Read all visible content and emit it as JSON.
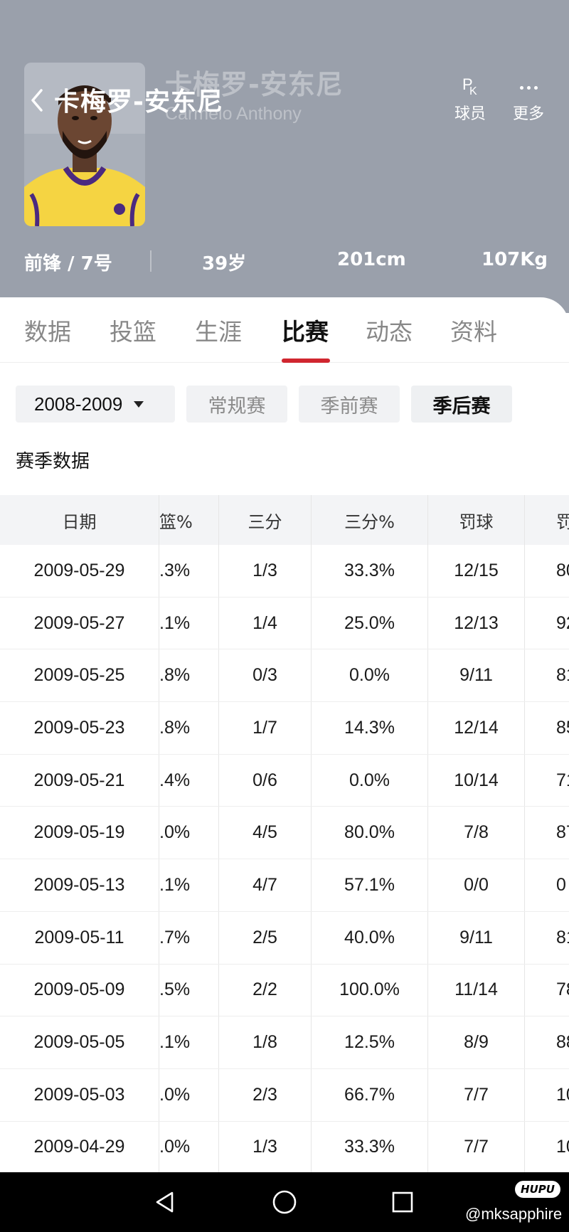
{
  "header": {
    "name_cn": "卡梅罗-安东尼",
    "name_en": "Carmelo Anthony",
    "pk_label": "球员",
    "more_label": "更多",
    "position": "前锋 / 7号",
    "age": "39岁",
    "height": "201cm",
    "weight": "107Kg"
  },
  "tabs": [
    {
      "label": "数据"
    },
    {
      "label": "投篮"
    },
    {
      "label": "生涯"
    },
    {
      "label": "比赛"
    },
    {
      "label": "动态"
    },
    {
      "label": "资料"
    }
  ],
  "active_tab": "比赛",
  "filters": {
    "season": "2008-2009",
    "chips": [
      {
        "label": "常规赛"
      },
      {
        "label": "季前赛"
      },
      {
        "label": "季后赛"
      }
    ],
    "active_chip": "季后赛"
  },
  "section_title": "赛季数据",
  "table": {
    "headers": [
      "日期",
      "篮%",
      "三分",
      "三分%",
      "罚球",
      "罚"
    ],
    "rows": [
      {
        "date": "2009-05-29",
        "fgp": ".3%",
        "tp": "1/3",
        "tpp": "33.3%",
        "ft": "12/15",
        "ftp": "80"
      },
      {
        "date": "2009-05-27",
        "fgp": ".1%",
        "tp": "1/4",
        "tpp": "25.0%",
        "ft": "12/13",
        "ftp": "92"
      },
      {
        "date": "2009-05-25",
        "fgp": ".8%",
        "tp": "0/3",
        "tpp": "0.0%",
        "ft": "9/11",
        "ftp": "81"
      },
      {
        "date": "2009-05-23",
        "fgp": ".8%",
        "tp": "1/7",
        "tpp": "14.3%",
        "ft": "12/14",
        "ftp": "85"
      },
      {
        "date": "2009-05-21",
        "fgp": ".4%",
        "tp": "0/6",
        "tpp": "0.0%",
        "ft": "10/14",
        "ftp": "71"
      },
      {
        "date": "2009-05-19",
        "fgp": ".0%",
        "tp": "4/5",
        "tpp": "80.0%",
        "ft": "7/8",
        "ftp": "87"
      },
      {
        "date": "2009-05-13",
        "fgp": ".1%",
        "tp": "4/7",
        "tpp": "57.1%",
        "ft": "0/0",
        "ftp": "0"
      },
      {
        "date": "2009-05-11",
        "fgp": ".7%",
        "tp": "2/5",
        "tpp": "40.0%",
        "ft": "9/11",
        "ftp": "81"
      },
      {
        "date": "2009-05-09",
        "fgp": ".5%",
        "tp": "2/2",
        "tpp": "100.0%",
        "ft": "11/14",
        "ftp": "78"
      },
      {
        "date": "2009-05-05",
        "fgp": ".1%",
        "tp": "1/8",
        "tpp": "12.5%",
        "ft": "8/9",
        "ftp": "88"
      },
      {
        "date": "2009-05-03",
        "fgp": ".0%",
        "tp": "2/3",
        "tpp": "66.7%",
        "ft": "7/7",
        "ftp": "10"
      },
      {
        "date": "2009-04-29",
        "fgp": ".0%",
        "tp": "1/3",
        "tpp": "33.3%",
        "ft": "7/7",
        "ftp": "10"
      }
    ]
  },
  "watermark": {
    "logo": "HUPU",
    "handle": "@mksapphire"
  },
  "colors": {
    "header_bg": "#9aa0ab",
    "accent": "#d0262f",
    "jersey": "#f5d442"
  },
  "icons": [
    "back-arrow-icon",
    "pk-icon",
    "more-dots-icon",
    "caret-down-icon",
    "nav-back-icon",
    "nav-home-icon",
    "nav-recent-icon"
  ]
}
